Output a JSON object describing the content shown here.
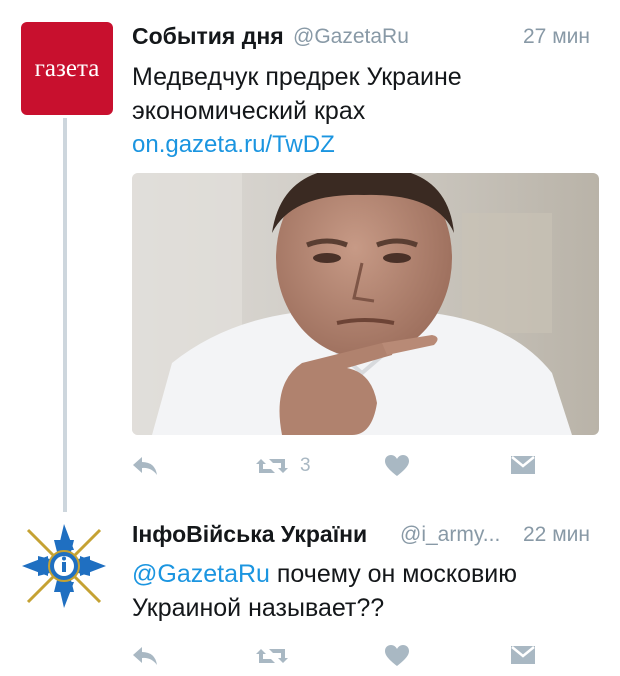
{
  "tweets": [
    {
      "author": "События дня",
      "handle": "@GazetaRu",
      "time": "27 мин",
      "avatar_text": "газета",
      "text_line1": "Медведчук предрек Украине",
      "text_line2": "экономический крах",
      "link": "on.gazeta.ru/TwDZ",
      "retweet_count": "3"
    },
    {
      "author": "ІнфоВійська України",
      "handle": "@i_army...",
      "time": "22 мин",
      "mention": "@GazetaRu",
      "text_rest": " почему он московию",
      "text_line2": "Украиной называет??"
    }
  ],
  "colors": {
    "brand_red": "#c8102e",
    "link_blue": "#1b95e0",
    "muted": "#8899a6",
    "icon_gray": "#a9b8c3"
  },
  "icons": [
    "reply-icon",
    "retweet-icon",
    "like-icon",
    "direct-message-icon"
  ]
}
